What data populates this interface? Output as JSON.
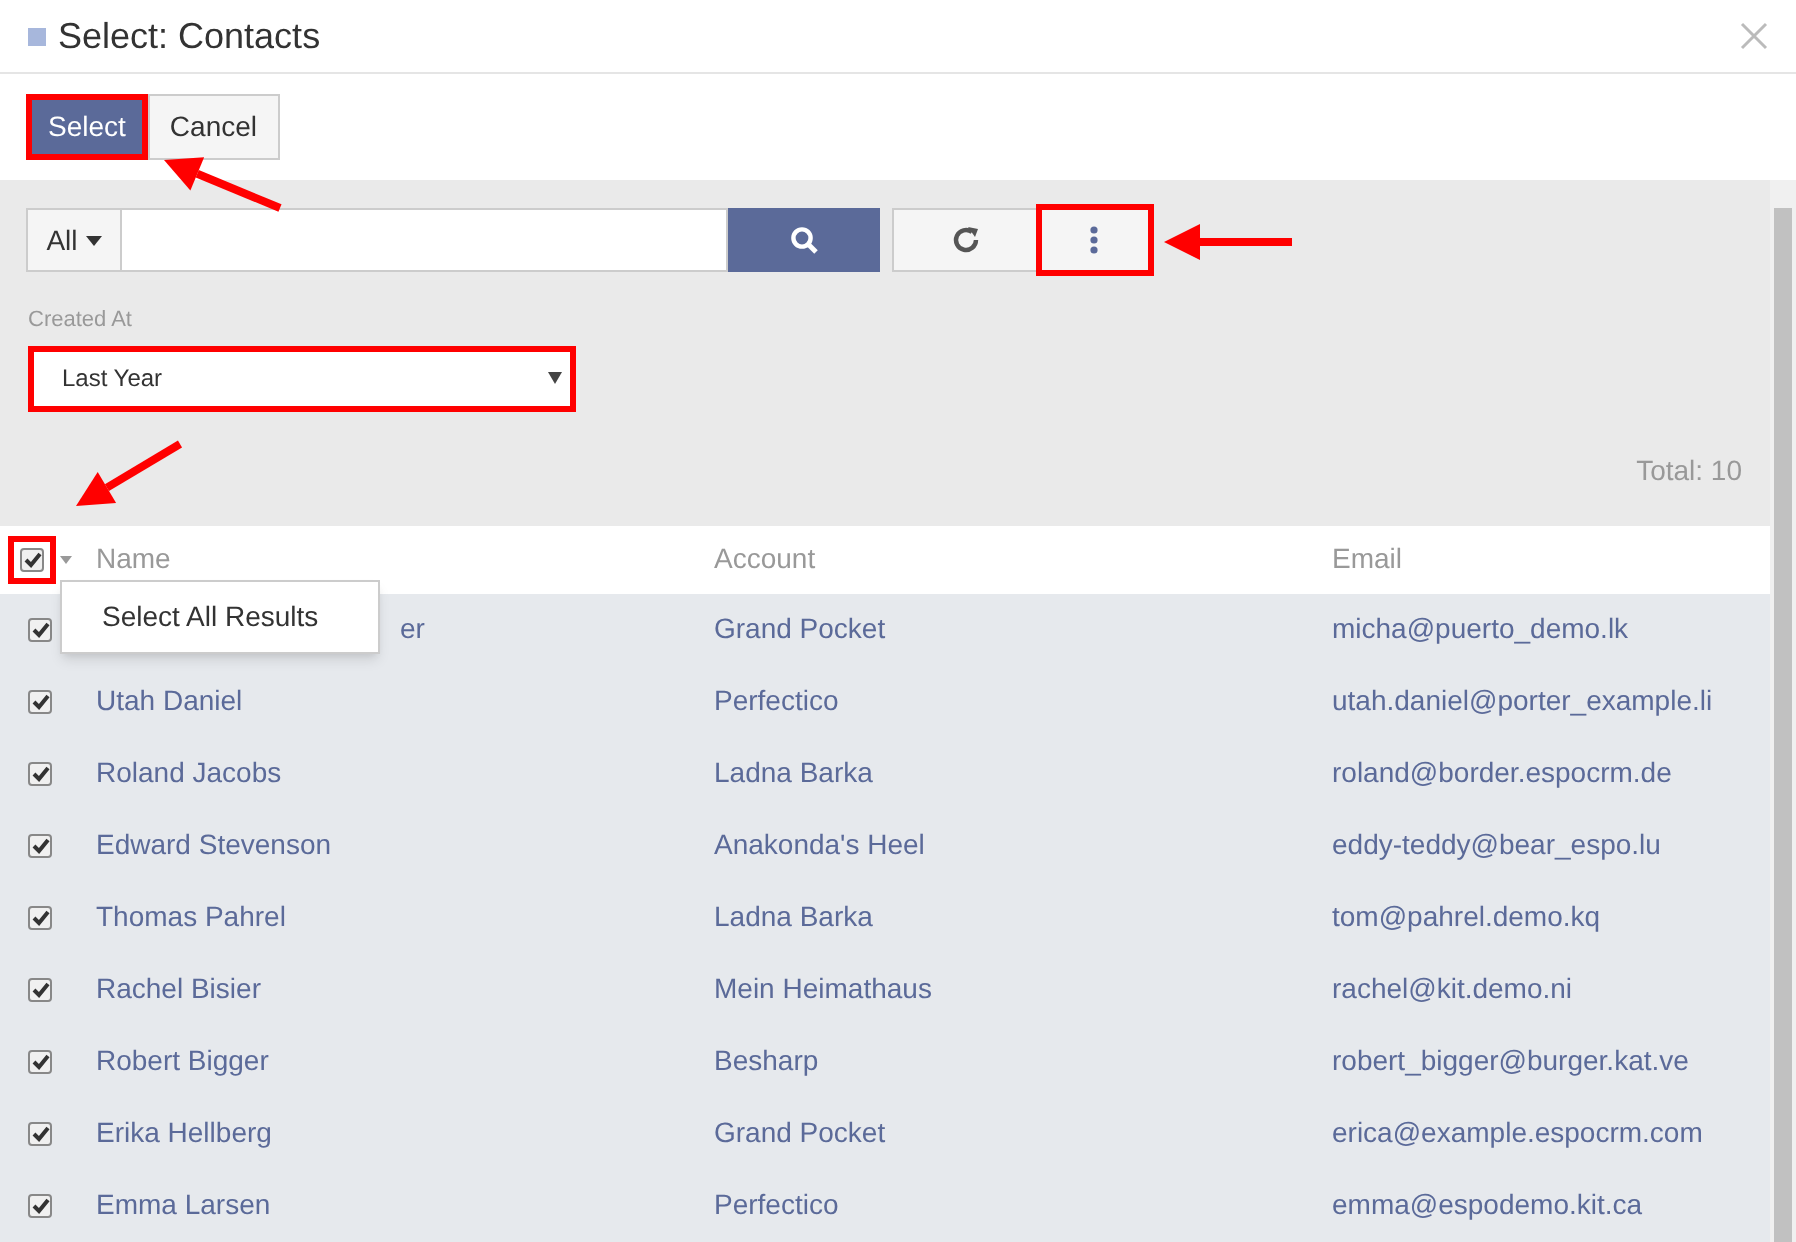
{
  "window": {
    "title": "Select: Contacts"
  },
  "actions": [
    {
      "label": "Select",
      "kind": "primary",
      "highlighted": true
    },
    {
      "label": "Cancel",
      "kind": "default",
      "highlighted": false
    }
  ],
  "search": {
    "scope": "All",
    "more_highlighted": true
  },
  "filter": {
    "label": "Created At",
    "value": "Last Year",
    "highlighted": true
  },
  "total": "Total: 10",
  "table": {
    "header_checked": true,
    "header_highlighted": true,
    "menu_open": true,
    "menu_item": "Select All Results",
    "columns": [
      "Name",
      "Account",
      "Email"
    ],
    "rows": [
      {
        "checked": true,
        "name": "er",
        "account": "Grand Pocket",
        "email": "micha@puerto_demo.lk"
      },
      {
        "checked": true,
        "name": "Utah Daniel",
        "account": "Perfectico",
        "email": "utah.daniel@porter_example.li"
      },
      {
        "checked": true,
        "name": "Roland Jacobs",
        "account": "Ladna Barka",
        "email": "roland@border.espocrm.de"
      },
      {
        "checked": true,
        "name": "Edward Stevenson",
        "account": "Anakonda's Heel",
        "email": "eddy-teddy@bear_espo.lu"
      },
      {
        "checked": true,
        "name": "Thomas Pahrel",
        "account": "Ladna Barka",
        "email": "tom@pahrel.demo.kq"
      },
      {
        "checked": true,
        "name": "Rachel Bisier",
        "account": "Mein Heimathaus",
        "email": "rachel@kit.demo.ni"
      },
      {
        "checked": true,
        "name": "Robert Bigger",
        "account": "Besharp",
        "email": "robert_bigger@burger.kat.ve"
      },
      {
        "checked": true,
        "name": "Erika Hellberg",
        "account": "Grand Pocket",
        "email": "erica@example.espocrm.com"
      },
      {
        "checked": true,
        "name": "Emma Larsen",
        "account": "Perfectico",
        "email": "emma@espodemo.kit.ca"
      }
    ]
  }
}
